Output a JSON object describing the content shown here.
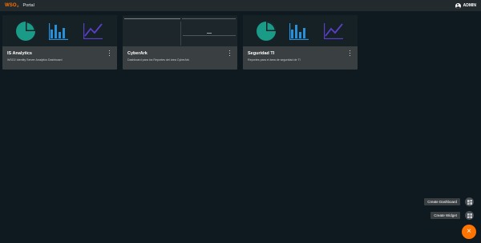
{
  "header": {
    "logo_main": "WSO",
    "logo_sup": "2",
    "title": "Portal",
    "user_label": "ADMIN"
  },
  "dashboards": [
    {
      "title": "IS Analytics",
      "description": "WSO2 Identity Server Analytics Dashboard",
      "thumbnail_icons": [
        "pie-chart-icon",
        "bar-chart-icon",
        "line-chart-icon"
      ]
    },
    {
      "title": "CyberArk",
      "description": "Dashboard para los Reportes del área CyberArk",
      "thumbnail": "dashboard-screenshot"
    },
    {
      "title": "Seguridad TI",
      "description": "Reportes para el área de seguridad de TI",
      "thumbnail_icons": [
        "pie-chart-icon",
        "bar-chart-icon",
        "line-chart-icon"
      ]
    }
  ],
  "actions": {
    "create_dashboard": "Create Dashboard",
    "create_widget": "Create Widget",
    "close_icon": "×"
  },
  "colors": {
    "accent": "#ff7300",
    "pie": "#1a9b87",
    "bar": "#2a8fd9",
    "line": "#5b3ec8",
    "background": "#0e1a20",
    "card": "#3a3f42"
  }
}
